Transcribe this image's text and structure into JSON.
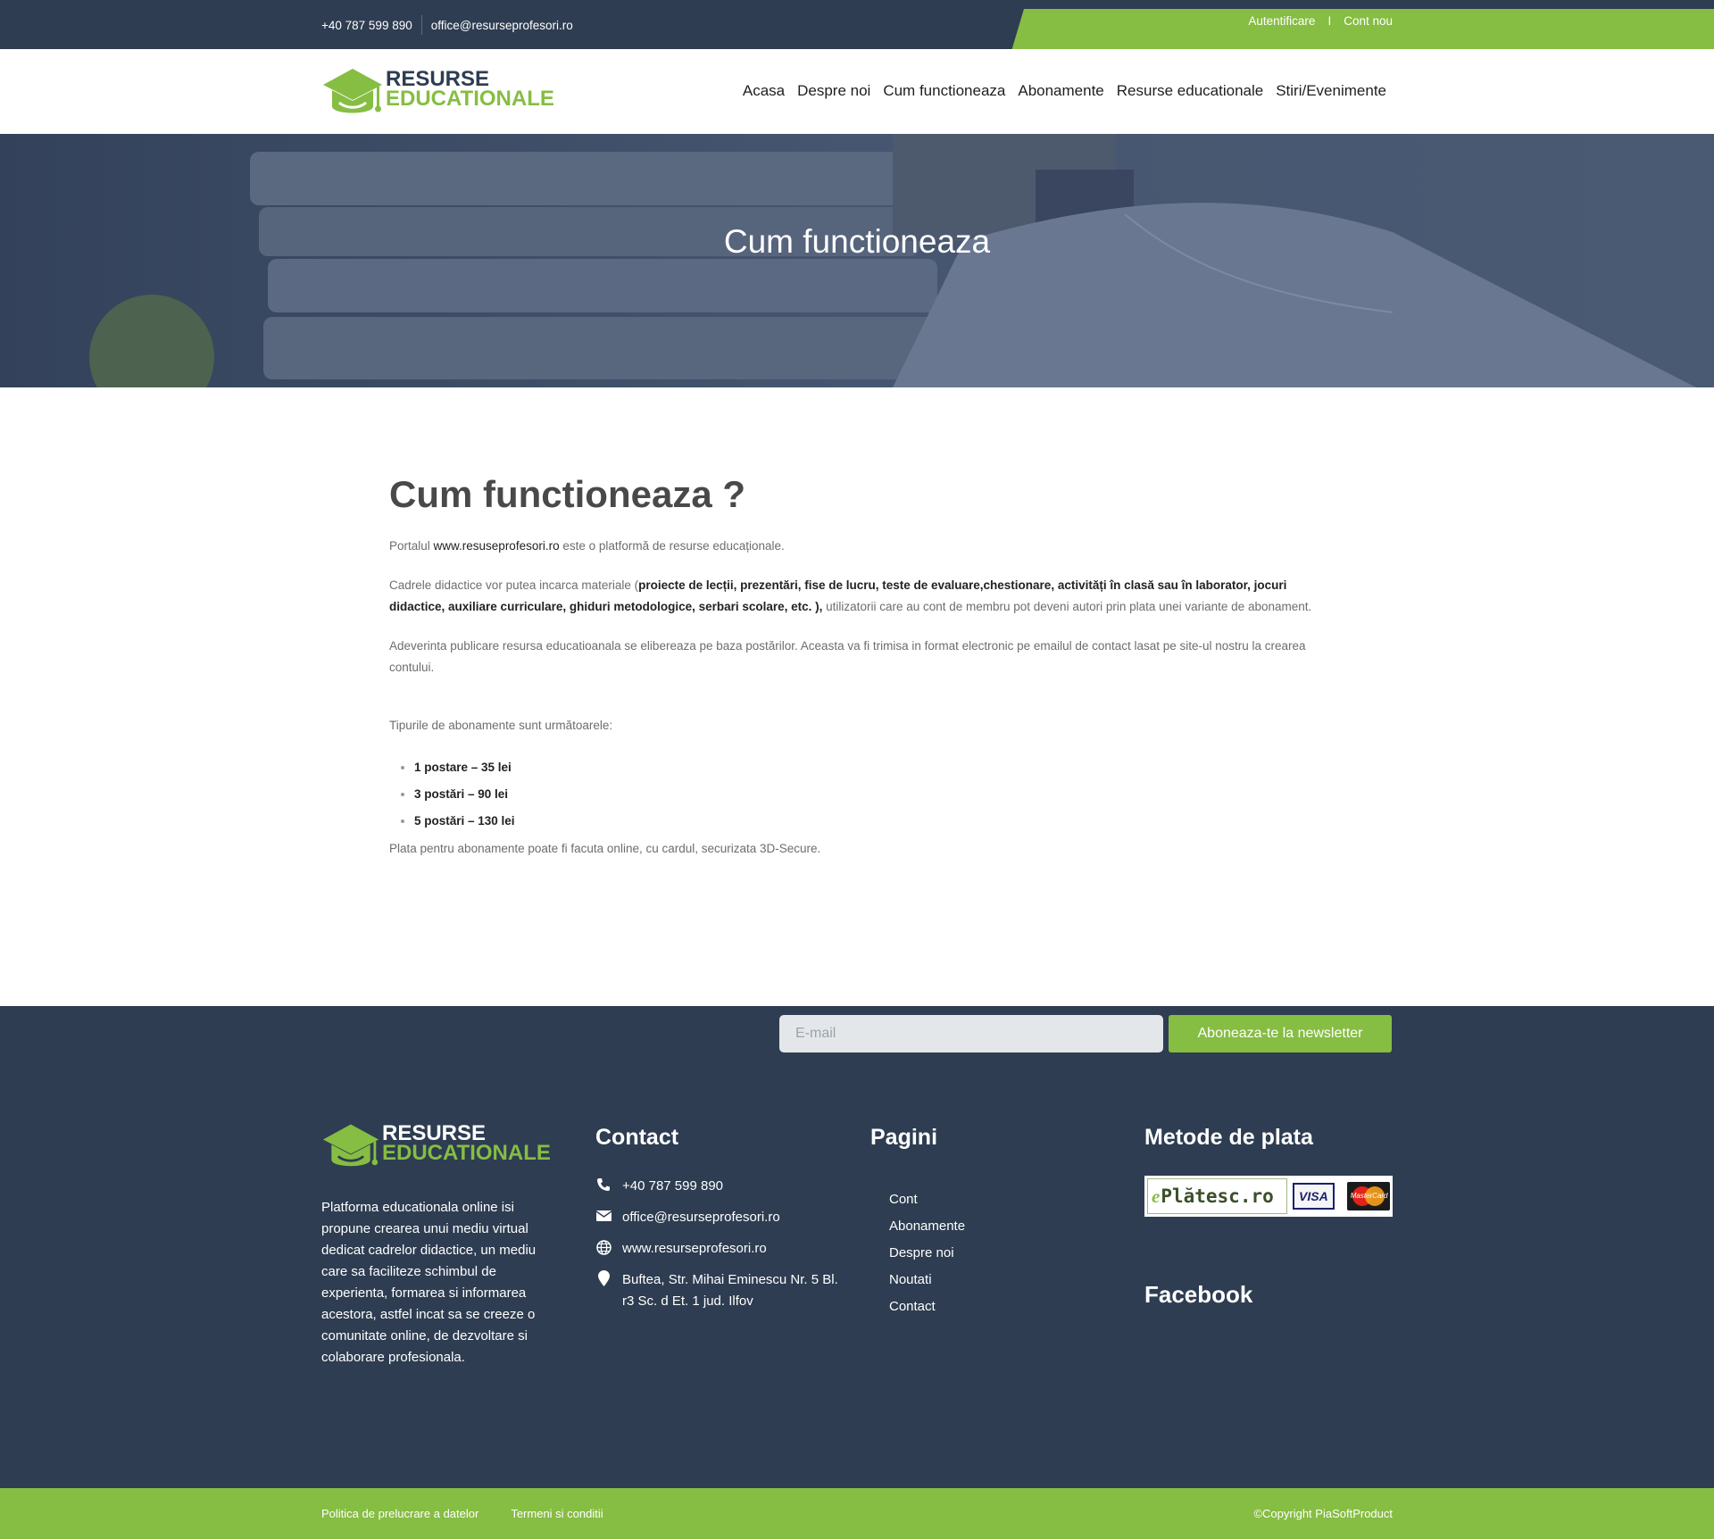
{
  "topbar": {
    "phone": "+40 787 599 890",
    "email": "office@resurseprofesori.ro",
    "login": "Autentificare",
    "separator": "I",
    "register": "Cont nou"
  },
  "brand": {
    "line1": "RESURSE",
    "line2": "EDUCATIONALE"
  },
  "nav": [
    "Acasa",
    "Despre noi",
    "Cum functioneaza",
    "Abonamente",
    "Resurse educationale",
    "Stiri/Evenimente"
  ],
  "hero": {
    "title": "Cum functioneaza"
  },
  "content": {
    "heading": "Cum functioneaza ?",
    "p1_before": "Portalul ",
    "p1_link": "www.resuseprofesori.ro",
    "p1_after": " este o platformă de resurse educaționale.",
    "p2_before": "Cadrele didactice vor putea incarca materiale (",
    "p2_bold": "proiecte de lecții, prezentări, fise de lucru, teste de evaluare,chestionare, activități în clasă sau în laborator, jocuri didactice, auxiliare curriculare, ghiduri metodologice, serbari scolare, etc. ),",
    "p2_after": " utilizatorii care au cont de membru pot deveni autori prin plata unei variante de abonament.",
    "p3": "Adeverinta publicare resursa educatioanala  se elibereaza pe baza postărilor. Aceasta va fi trimisa in format electronic pe emailul de contact lasat pe site-ul nostru la crearea contului.",
    "p4": "Tipurile de abonamente sunt următoarele:",
    "plans": [
      "1 postare – 35 lei",
      "3 postări – 90 lei",
      "5 postări – 130 lei"
    ],
    "p5": "Plata pentru abonamente poate fi facuta online, cu cardul, securizata 3D-Secure."
  },
  "newsletter": {
    "placeholder": "E-mail",
    "button": "Aboneaza-te la newsletter"
  },
  "footer": {
    "about": "Platforma educationala online isi propune crearea unui mediu virtual dedicat cadrelor didactice, un mediu care sa faciliteze schimbul de experienta, formarea si informarea acestora, astfel incat sa se creeze o comunitate online, de dezvoltare si colaborare profesionala.",
    "contact_title": "Contact",
    "contact_phone": "+40 787 599 890",
    "contact_email": "office@resurseprofesori.ro",
    "contact_web": "www.resurseprofesori.ro",
    "contact_address": "Buftea, Str. Mihai Eminescu Nr. 5 Bl. r3 Sc. d Et. 1 jud. Ilfov",
    "pages_title": "Pagini",
    "pages": [
      "Cont",
      "Abonamente",
      "Despre noi",
      "Noutati",
      "Contact"
    ],
    "pay_title": "Metode de plata",
    "pay_eplat_e": "e",
    "pay_eplat_text": "Plătesc.ro",
    "pay_visa": "VISA",
    "pay_mc": "MasterCard",
    "facebook_title": "Facebook"
  },
  "bottombar": {
    "privacy": "Politica de prelucrare a datelor",
    "terms": "Termeni si conditii",
    "copyright": "©Copyright PiaSoftProduct"
  },
  "colors": {
    "navy": "#2e3d51",
    "green": "#86bd43"
  }
}
